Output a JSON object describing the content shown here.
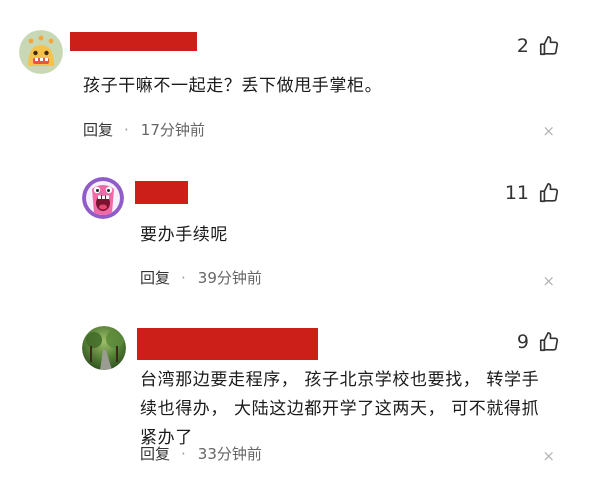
{
  "comments": [
    {
      "likes": "2",
      "text": "孩子干嘛不一起走？丢下做甩手掌柜。",
      "reply_label": "回复",
      "dot": "·",
      "time": "17分钟前",
      "close": "×",
      "avatar_icon": "yellow-monster-avatar"
    },
    {
      "likes": "11",
      "text": "要办手续呢",
      "reply_label": "回复",
      "dot": "·",
      "time": "39分钟前",
      "close": "×",
      "avatar_icon": "pink-screaming-monster-avatar"
    },
    {
      "likes": "9",
      "text": "台湾那边要走程序， 孩子北京学校也要找， 转学手续也得办， 大陆这边都开学了这两天， 可不就得抓紧办了",
      "reply_label": "回复",
      "dot": "·",
      "time": "33分钟前",
      "close": "×",
      "avatar_icon": "green-road-photo-avatar"
    }
  ],
  "icons": {
    "like": "thumbs-up-icon",
    "close": "close-icon"
  },
  "colors": {
    "redaction": "#cc1f1a",
    "text": "#1a1a1a",
    "meta": "#666666",
    "close": "#b4b4b4"
  }
}
